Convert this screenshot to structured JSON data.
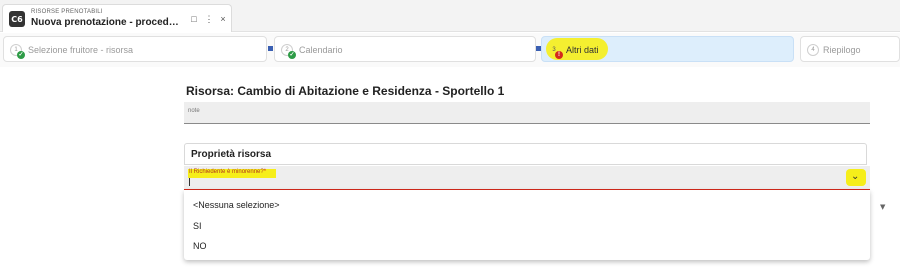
{
  "tab": {
    "logo_text": "C6",
    "subtitle": "RISORSE PRENOTABILI",
    "title": "Nuova prenotazione - procedura guid...",
    "pin_icon": "□",
    "more_icon": "⋮",
    "close_icon": "×"
  },
  "stepper": {
    "steps": [
      {
        "number": "1",
        "label": "Selezione fruitore - risorsa",
        "status": "completed",
        "badge": "✓"
      },
      {
        "number": "2",
        "label": "Calendario",
        "status": "completed",
        "badge": "✓"
      },
      {
        "number": "3",
        "label": "Altri dati",
        "status": "active-error",
        "badge": "!"
      },
      {
        "number": "4",
        "label": "Riepilogo",
        "status": "pending",
        "badge": ""
      }
    ]
  },
  "form": {
    "resource_title": "Risorsa: Cambio di Abitazione e Residenza - Sportello 1",
    "note_label": "note",
    "properties_title": "Proprietà risorsa",
    "select_label": "Il Richiedente è minorenne?",
    "required_mark": "*",
    "select_arrow": "⌄",
    "options": [
      "<Nessuna selezione>",
      "SI",
      "NO"
    ]
  },
  "colors": {
    "active_step_bg": "#ddeefc",
    "highlight": "#f6ee1a",
    "error": "#d4291c",
    "success": "#2e9c47",
    "connector": "#3a5fb2"
  }
}
